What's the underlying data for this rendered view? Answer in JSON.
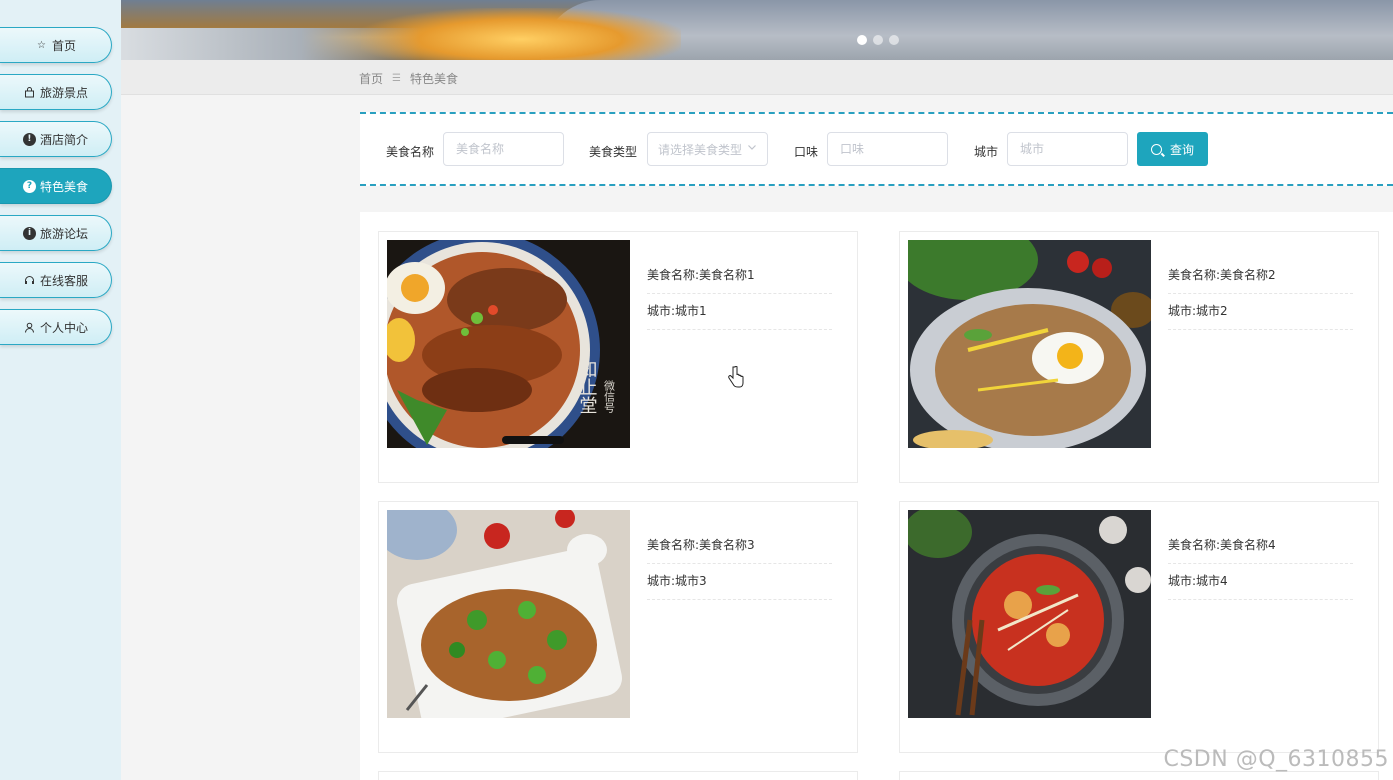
{
  "sidebar": {
    "items": [
      {
        "label": "首页",
        "icon": "star-icon"
      },
      {
        "label": "旅游景点",
        "icon": "bag-icon"
      },
      {
        "label": "酒店简介",
        "icon": "info-icon"
      },
      {
        "label": "特色美食",
        "icon": "help-icon",
        "active": true
      },
      {
        "label": "旅游论坛",
        "icon": "info-icon"
      },
      {
        "label": "在线客服",
        "icon": "headset-icon"
      },
      {
        "label": "个人中心",
        "icon": "user-icon"
      }
    ]
  },
  "banner": {
    "slide_count": 3,
    "active_slide": 1
  },
  "breadcrumb": {
    "home": "首页",
    "current": "特色美食"
  },
  "search": {
    "name_label": "美食名称",
    "name_placeholder": "美食名称",
    "type_label": "美食类型",
    "type_placeholder": "请选择美食类型",
    "taste_label": "口味",
    "taste_placeholder": "口味",
    "city_label": "城市",
    "city_placeholder": "城市",
    "button_label": "查询"
  },
  "cards": [
    {
      "name": "美食名称:美食名称1",
      "city": "城市:城市1"
    },
    {
      "name": "美食名称:美食名称2",
      "city": "城市:城市2"
    },
    {
      "name": "美食名称:美食名称3",
      "city": "城市:城市3"
    },
    {
      "name": "美食名称:美食名称4",
      "city": "城市:城市4"
    }
  ],
  "photo_text": {
    "brand_a": "知止堂",
    "brand_b": "微信号"
  },
  "watermark": "CSDN @Q_6310855",
  "colors": {
    "accent": "#1ea5bd",
    "sidebar_bg": "#e3f1f6",
    "dash": "#2aa0c0"
  }
}
